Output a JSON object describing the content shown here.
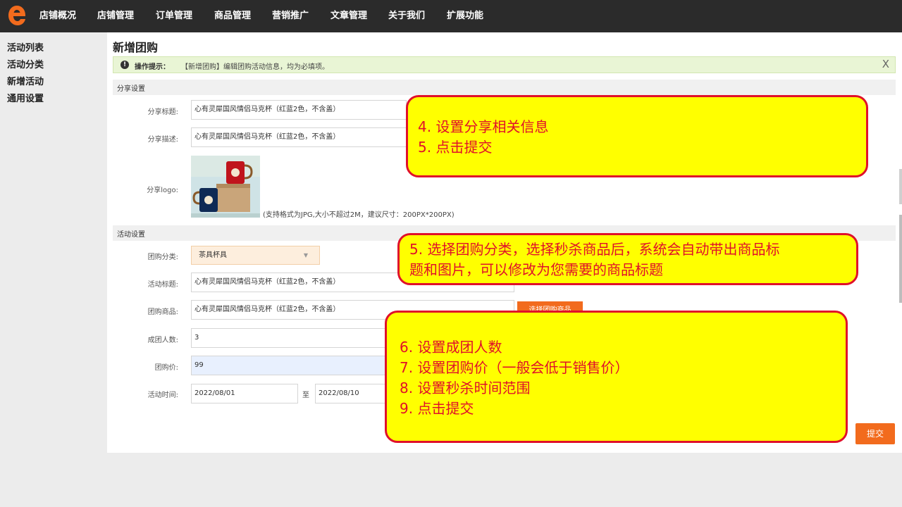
{
  "nav": {
    "items": [
      "店铺概况",
      "店铺管理",
      "订单管理",
      "商品管理",
      "营销推广",
      "文章管理",
      "关于我们",
      "扩展功能"
    ]
  },
  "sidebar": {
    "items": [
      "活动列表",
      "活动分类",
      "新增活动",
      "通用设置"
    ]
  },
  "page": {
    "title": "新增团购"
  },
  "tip": {
    "icon": "!",
    "label": "操作提示：",
    "text": "【新增团购】编辑团购活动信息，均为必填项。",
    "close": "X"
  },
  "share": {
    "section_title": "分享设置",
    "title_label": "分享标题:",
    "title_value": "心有灵犀国风情侣马克杯（红蓝2色，不含盖）",
    "desc_label": "分享描述:",
    "desc_value": "心有灵犀国风情侣马克杯（红蓝2色，不含盖）",
    "logo_label": "分享logo:",
    "logo_hint": "(支持格式为JPG,大小不超过2M，建议尺寸：200PX*200PX)"
  },
  "activity": {
    "section_title": "活动设置",
    "category_label": "团购分类:",
    "category_value": "茶具杯具",
    "title_label": "活动标题:",
    "title_value": "心有灵犀国风情侣马克杯（红蓝2色，不含盖）",
    "product_label": "团购商品:",
    "product_value": "心有灵犀国风情侣马克杯（红蓝2色，不含盖）",
    "choose_button": "选择团购商品",
    "people_label": "成团人数:",
    "people_value": "3",
    "price_label": "团购价:",
    "price_value": "99",
    "time_label": "活动时间:",
    "start_date": "2022/08/01",
    "to": "至",
    "end_date": "2022/08/10",
    "submit": "提交"
  },
  "callouts": {
    "c1": [
      "4. 设置分享相关信息",
      "5. 点击提交"
    ],
    "c2": [
      "5. 选择团购分类，选择秒杀商品后，系统会自动带出商品标",
      "题和图片，可以修改为您需要的商品标题"
    ],
    "c3": [
      "6. 设置成团人数",
      "7. 设置团购价（一般会低于销售价）",
      "8. 设置秒杀时间范围",
      "9. 点击提交"
    ]
  },
  "colors": {
    "accent": "#f26b1d",
    "callout_bg": "#ffff00",
    "callout_border": "#e0102a",
    "topbar": "#2b2b2b"
  }
}
